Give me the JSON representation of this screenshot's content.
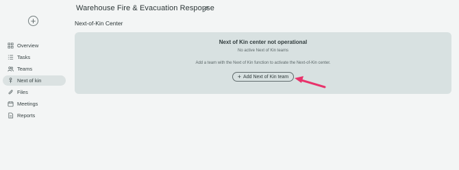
{
  "header": {
    "title": "Warehouse Fire & Evacuation Response",
    "section_title": "Next-of-Kin Center"
  },
  "sidebar": {
    "items": [
      {
        "label": "Overview",
        "icon": "grid-icon"
      },
      {
        "label": "Tasks",
        "icon": "list-icon"
      },
      {
        "label": "Teams",
        "icon": "people-icon"
      },
      {
        "label": "Next of kin",
        "icon": "person-icon",
        "active": true
      },
      {
        "label": "Files",
        "icon": "paperclip-icon"
      },
      {
        "label": "Meetings",
        "icon": "calendar-icon"
      },
      {
        "label": "Reports",
        "icon": "document-icon"
      }
    ]
  },
  "card": {
    "heading": "Next of Kin center not operational",
    "subtext": "No active Next of Kin teams",
    "description": "Add a team with the Next of Kin function to activate the Next-of-Kin center.",
    "button_label": "Add Next of Kin team"
  },
  "colors": {
    "background": "#f3f5f5",
    "card": "#d8e1e1",
    "active_nav": "#dbe2e2",
    "arrow": "#e8336b"
  }
}
